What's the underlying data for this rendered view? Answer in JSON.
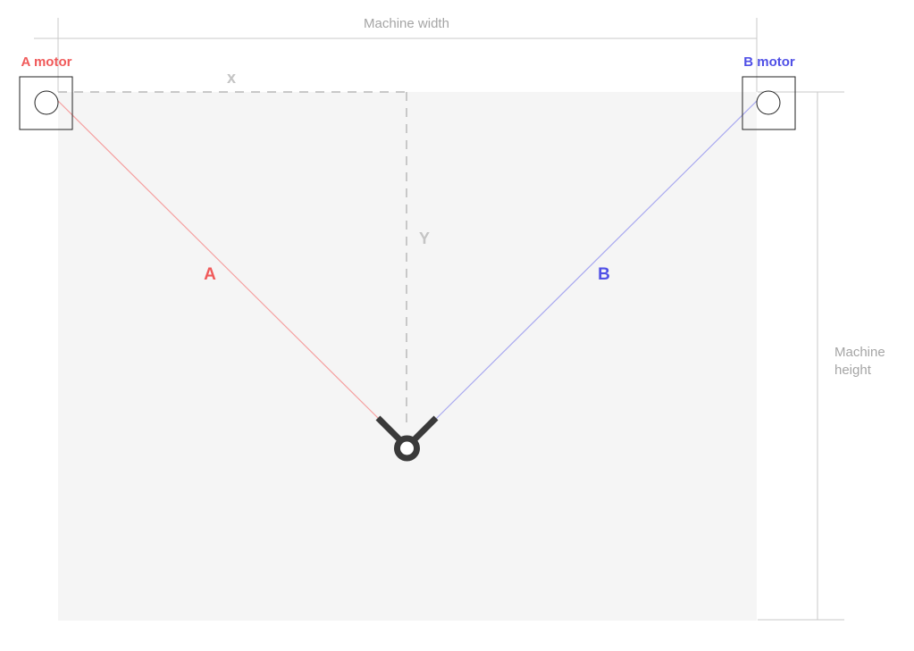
{
  "labels": {
    "machine_width": "Machine width",
    "machine_height_line1": "Machine",
    "machine_height_line2": "height",
    "motor_a": "A motor",
    "motor_b": "B motor",
    "cord_a": "A",
    "cord_b": "B",
    "coord_x": "x",
    "coord_y": "Y"
  },
  "colors": {
    "motor_a": "#f05a5a",
    "motor_b": "#5050e6",
    "cord_a": "#f5a0a0",
    "cord_b": "#a8a8f0",
    "work_area": "#f5f5f5",
    "dimension": "#c8c8c8",
    "gondola": "#3a3a3a"
  }
}
